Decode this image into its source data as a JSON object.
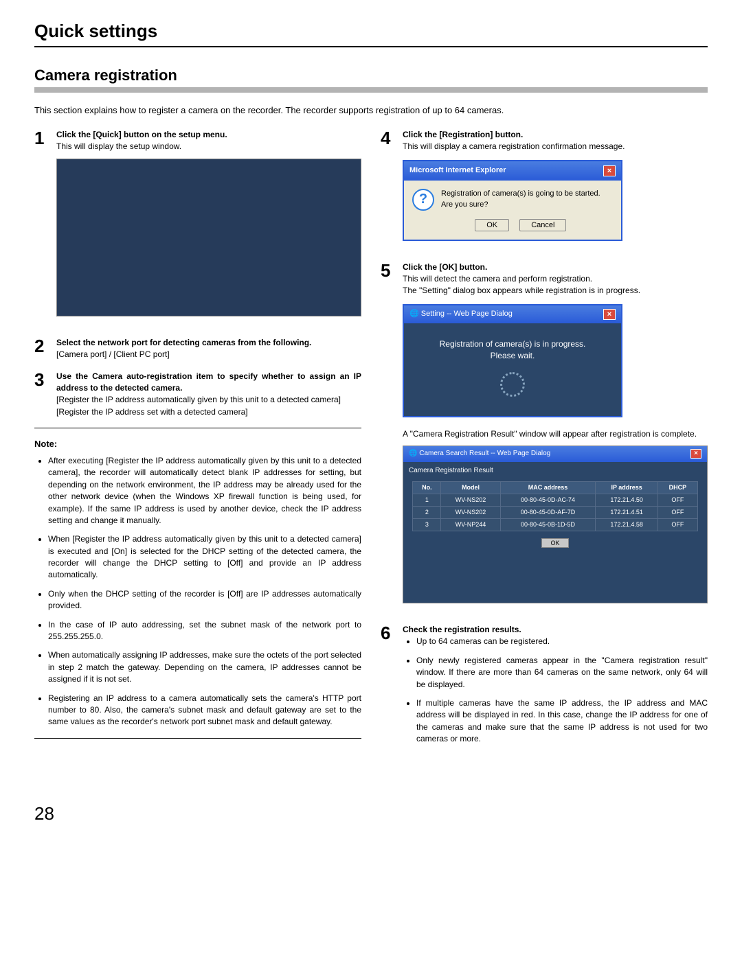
{
  "page_title": "Quick settings",
  "section_title": "Camera registration",
  "intro": "This section explains how to register a camera on the recorder. The recorder supports registration of up to 64 cameras.",
  "left": {
    "step1_bold": "Click the [Quick] button on the setup menu.",
    "step1_text": "This will display the setup window.",
    "step2_bold": "Select the network port for detecting cameras from the following.",
    "step2_text": "[Camera port] / [Client PC port]",
    "step3_bold": "Use the Camera auto-registration item to specify whether to assign an IP address to the detected camera.",
    "step3_text1": "[Register the IP address automatically given by this unit to a detected camera]",
    "step3_text2": "[Register the IP address set with a detected camera]",
    "note_head": "Note:",
    "notes": [
      "After executing [Register the IP address automatically given by this unit to a detected camera], the recorder will automatically detect blank IP addresses for setting, but depending on the network environment, the IP address may be already used for the other network device (when the Windows XP firewall function is being used, for example). If the same IP address is used by another device, check the IP address setting and change it manually.",
      "When [Register the IP address automatically given by this unit to a detected camera] is executed and [On] is selected for the DHCP setting of the detected camera, the recorder will change the DHCP setting to [Off] and provide an IP address automatically.",
      "Only when the DHCP setting of the recorder is [Off] are IP addresses automatically provided.",
      "In the case of IP auto addressing, set the subnet mask of the network port to 255.255.255.0.",
      "When automatically assigning IP addresses, make sure the octets of the port selected in step 2 match the gateway. Depending on the camera, IP addresses cannot be assigned if it is not set.",
      "Registering an IP address to a camera automatically sets the camera's HTTP port number to 80. Also, the camera's subnet mask and default gateway are set to the same values as the recorder's network port subnet mask and default gateway."
    ]
  },
  "right": {
    "step4_bold": "Click the [Registration] button.",
    "step4_text": "This will display a camera registration confirmation message.",
    "dialog_ie_title": "Microsoft Internet Explorer",
    "dialog_ie_msg1": "Registration of camera(s) is going to be started.",
    "dialog_ie_msg2": "Are you sure?",
    "dialog_ok": "OK",
    "dialog_cancel": "Cancel",
    "step5_bold": "Click the [OK] button.",
    "step5_text1": "This will detect the camera and perform registration.",
    "step5_text2": "The \"Setting\" dialog box appears while registration is in progress.",
    "dialog_prog_title": "Setting -- Web Page Dialog",
    "dialog_prog_msg1": "Registration of camera(s) is in progress.",
    "dialog_prog_msg2": "Please wait.",
    "step5_text3": "A \"Camera Registration Result\" window will appear after registration is complete.",
    "result_title": "Camera Search Result -- Web Page Dialog",
    "result_sub": "Camera Registration Result",
    "result_headers": [
      "No.",
      "Model",
      "MAC address",
      "IP address",
      "DHCP"
    ],
    "result_rows": [
      [
        "1",
        "WV-NS202",
        "00-80-45-0D-AC-74",
        "172.21.4.50",
        "OFF"
      ],
      [
        "2",
        "WV-NS202",
        "00-80-45-0D-AF-7D",
        "172.21.4.51",
        "OFF"
      ],
      [
        "3",
        "WV-NP244",
        "00-80-45-0B-1D-5D",
        "172.21.4.58",
        "OFF"
      ]
    ],
    "result_ok": "OK",
    "step6_bold": "Check the registration results.",
    "step6_notes": [
      "Up to 64 cameras can be registered.",
      "Only newly registered cameras appear in the \"Camera registration result\" window. If there are more than 64 cameras on the same network, only 64 will be displayed.",
      "If multiple cameras have the same IP address, the IP address and MAC address will be displayed in red. In this case, change the IP address for one of the cameras and make sure that the same IP address is not used for two cameras or more."
    ]
  },
  "page_number": "28"
}
